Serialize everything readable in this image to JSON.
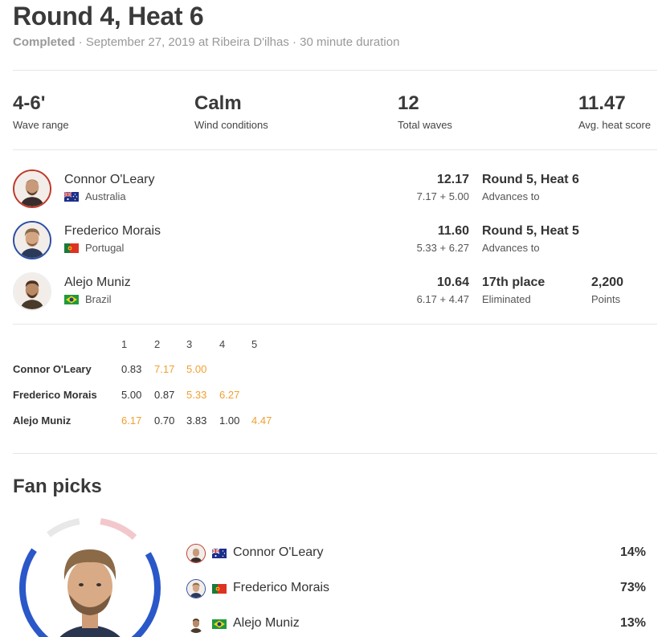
{
  "heat": {
    "title": "Round 4, Heat 6",
    "status": "Completed",
    "details": " · September 27, 2019 at Ribeira D'ilhas · 30 minute duration"
  },
  "stats": [
    {
      "value": "4-6'",
      "label": "Wave range"
    },
    {
      "value": "Calm",
      "label": "Wind conditions"
    },
    {
      "value": "12",
      "label": "Total waves"
    },
    {
      "value": "11.47",
      "label": "Avg. heat score"
    }
  ],
  "surfers": [
    {
      "name": "Connor O'Leary",
      "country": "Australia",
      "total": "12.17",
      "waves": "7.17 + 5.00",
      "outcome": "Round 5, Heat 6",
      "outcome_sub": "Advances to",
      "points": "",
      "points_label": "",
      "ring_color": "#c0392b"
    },
    {
      "name": "Frederico Morais",
      "country": "Portugal",
      "total": "11.60",
      "waves": "5.33 + 6.27",
      "outcome": "Round 5, Heat 5",
      "outcome_sub": "Advances to",
      "points": "",
      "points_label": "",
      "ring_color": "#2d4fa3"
    },
    {
      "name": "Alejo Muniz",
      "country": "Brazil",
      "total": "10.64",
      "waves": "6.17 + 4.47",
      "outcome": "17th place",
      "outcome_sub": "Eliminated",
      "points": "2,200",
      "points_label": "Points",
      "ring_color": "#eeeeee"
    }
  ],
  "wave_table": {
    "columns": [
      "1",
      "2",
      "3",
      "4",
      "5"
    ],
    "rows": [
      {
        "name": "Connor O'Leary",
        "scores": [
          "0.83",
          "7.17",
          "5.00",
          "",
          ""
        ],
        "counted": [
          false,
          true,
          true,
          false,
          false
        ]
      },
      {
        "name": "Frederico Morais",
        "scores": [
          "5.00",
          "0.87",
          "5.33",
          "6.27",
          ""
        ],
        "counted": [
          false,
          false,
          true,
          true,
          false
        ]
      },
      {
        "name": "Alejo Muniz",
        "scores": [
          "6.17",
          "0.70",
          "3.83",
          "1.00",
          "4.47"
        ],
        "counted": [
          true,
          false,
          false,
          false,
          true
        ]
      }
    ],
    "highlight_color": "#f0a030"
  },
  "fan_picks": {
    "title": "Fan picks",
    "picks": [
      {
        "name": "Connor O'Leary",
        "pct": "14%",
        "fraction": 0.14,
        "color": "#f2c8cc"
      },
      {
        "name": "Frederico Morais",
        "pct": "73%",
        "fraction": 0.73,
        "color": "#2a58c9"
      },
      {
        "name": "Alejo Muniz",
        "pct": "13%",
        "fraction": 0.13,
        "color": "#e8e8e8"
      }
    ],
    "featured": "Frederico Morais"
  },
  "icons": {
    "flag_australia": "australia-flag-icon",
    "flag_portugal": "portugal-flag-icon",
    "flag_brazil": "brazil-flag-icon"
  }
}
